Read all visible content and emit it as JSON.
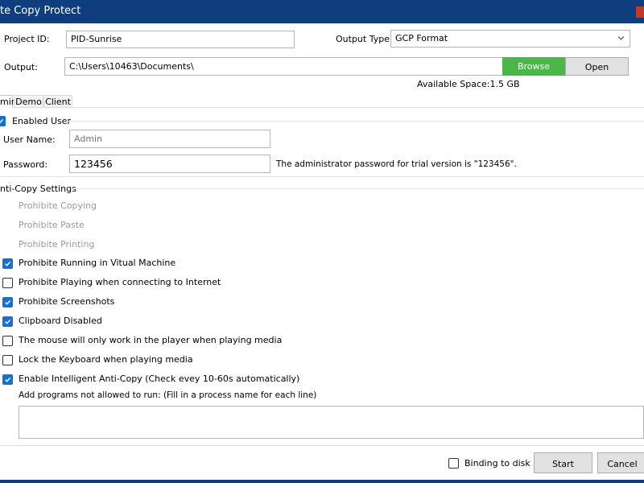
{
  "window": {
    "title": "te Copy Protect"
  },
  "project": {
    "id_label": "Project ID:",
    "id_value": "PID-Sunrise",
    "output_type_label": "Output Type:",
    "output_type_value": "GCP Format"
  },
  "output": {
    "label": "Output:",
    "path": "C:\\Users\\10463\\Documents\\",
    "browse_label": "Browse",
    "open_label": "Open",
    "available_space": "Available Space:1.5 GB"
  },
  "tabs": [
    {
      "label": "min"
    },
    {
      "label": "Demo"
    },
    {
      "label": "Client"
    }
  ],
  "admin": {
    "enabled_user_label": "Enabled User",
    "enabled_user_checked": true,
    "username_label": "User Name:",
    "username_placeholder": "Admin",
    "password_label": "Password:",
    "password_value": "123456",
    "password_note": "The administrator password for trial version is \"123456\"."
  },
  "anticopy": {
    "section_label": "nti-Copy Settings",
    "options": [
      {
        "label": "Prohibite Copying",
        "state": "disabled"
      },
      {
        "label": "Prohibite Paste",
        "state": "disabled"
      },
      {
        "label": "Prohibite Printing",
        "state": "disabled"
      },
      {
        "label": "Prohibite Running in Vitual Machine",
        "state": "on"
      },
      {
        "label": "Prohibite Playing when connecting to Internet",
        "state": "off"
      },
      {
        "label": "Prohibite Screenshots",
        "state": "on"
      },
      {
        "label": "Clipboard Disabled",
        "state": "on"
      },
      {
        "label": "The mouse will only work in the player when playing media",
        "state": "off"
      },
      {
        "label": "Lock the Keyboard when playing media",
        "state": "off"
      },
      {
        "label": "Enable Intelligent Anti-Copy (Check evey 10-60s automatically)",
        "state": "on"
      }
    ],
    "programs_label": "Add programs not allowed to run: (Fill in a process name for each line)"
  },
  "footer": {
    "binding_label": "Binding to disk",
    "binding_checked": false,
    "start_label": "Start",
    "cancel_label": "Cancel"
  },
  "colors": {
    "titlebar": "#0e3e7e",
    "browse": "#4ab848",
    "checkbox_on": "#1470d8"
  }
}
